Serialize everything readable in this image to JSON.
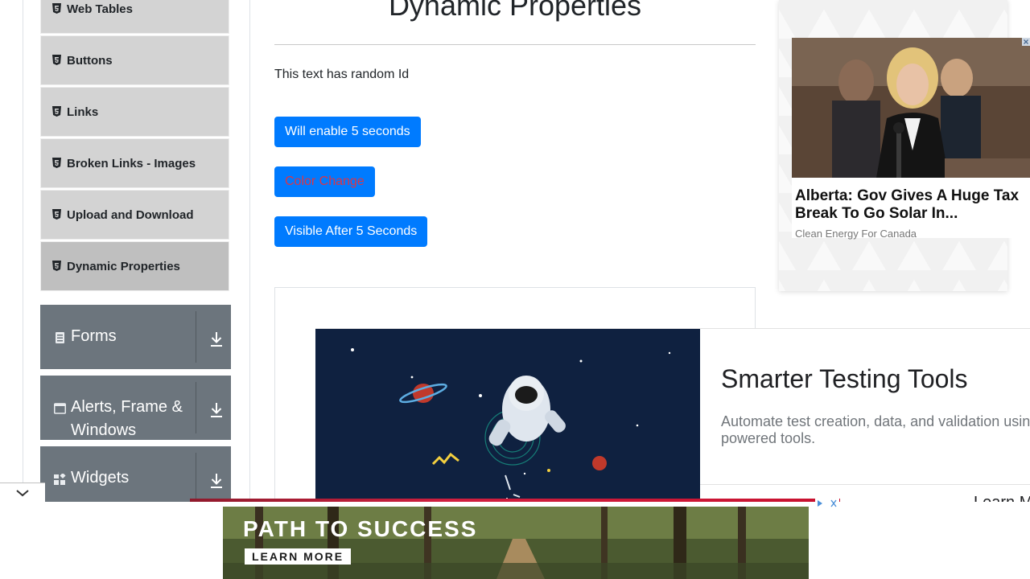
{
  "sidebar": {
    "elements": [
      {
        "label": "Web Tables",
        "icon": "html5-icon"
      },
      {
        "label": "Buttons",
        "icon": "html5-icon"
      },
      {
        "label": "Links",
        "icon": "html5-icon"
      },
      {
        "label": "Broken Links - Images",
        "icon": "html5-icon"
      },
      {
        "label": "Upload and Download",
        "icon": "html5-icon"
      },
      {
        "label": "Dynamic Properties",
        "icon": "html5-icon",
        "active": true
      }
    ],
    "groups": [
      {
        "label": "Forms",
        "icon": "form-icon"
      },
      {
        "label": "Alerts, Frame & Windows",
        "icon": "window-icon"
      },
      {
        "label": "Widgets",
        "icon": "widgets-icon"
      }
    ],
    "group_arrow_icon": "download-arrow-icon"
  },
  "main": {
    "title": "Dynamic Properties",
    "random_text": "This text has random Id",
    "buttons": {
      "enable_after": "Will enable 5 seconds",
      "color_change": "Color Change",
      "visible_after": "Visible After 5 Seconds"
    }
  },
  "ad_right": {
    "headline": "Alberta: Gov Gives A Huge Tax Break To Go Solar In...",
    "source": "Clean Energy For Canada"
  },
  "ad_mid": {
    "title": "Smarter Testing Tools",
    "body": "Automate test creation, data, and validation usin powered tools.",
    "more": "Learn M"
  },
  "banner": {
    "title": "PATH TO SUCCESS",
    "cta": "LEARN MORE"
  },
  "colors": {
    "primary": "#007bff",
    "danger": "#dc3545",
    "sidebar_group": "#6c757d",
    "sidebar_item": "#d3d3d3"
  }
}
